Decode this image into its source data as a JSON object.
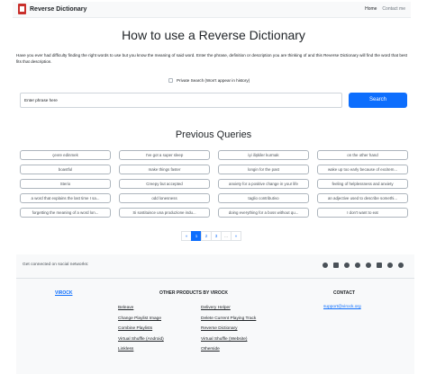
{
  "nav": {
    "brand": "Reverse Dictionary",
    "links": [
      "Home",
      "Contact me"
    ]
  },
  "main": {
    "title": "How to use a Reverse Dictionary",
    "intro": "Have you ever had difficulty finding the right words to use but you know the meaning of said word. Enter the phrase, definition or description you are thinking of and this Reverse Dictionary will find the word that best fits that description.",
    "private_label": "Private Search (Won't appear in history)",
    "search_placeholder": "Enter phrase here",
    "search_button": "Search"
  },
  "queries": {
    "title": "Previous Queries",
    "items": [
      "çevre edinmek",
      "I've got a super sleep",
      "iyi ilişkiler kurmak",
      "on the other hand",
      "boastful",
      "make things faster",
      "longin for the past",
      "wake up too early because of excitem...",
      "Sterio",
      "Creepy but accepted",
      "anxiety for a positive change in your life",
      "feeling of helplessness and anxiety",
      "a word that explains the last time I sa...",
      "odd lonesness",
      "taglio contributivo",
      "an adjective used to describe somethi...",
      "forgetting the meaning of a word lon...",
      "Si sostituisce una produzione indu...",
      "doing everything for a boss without qu...",
      "I don't want to eat"
    ]
  },
  "pagination": [
    "«",
    "1",
    "2",
    "3",
    "...",
    "»"
  ],
  "footer": {
    "social_text": "Get connected on social networks:",
    "social_icons": [
      "facebook-icon",
      "instagram-icon",
      "snapchat-icon",
      "twitter-icon",
      "telegram-icon",
      "youtube-icon",
      "tiktok-icon",
      "reddit-icon"
    ],
    "col1_title": "VIROCK",
    "col2_title": "OTHER PRODUCTS BY VIROCK",
    "col3_title": "CONTACT",
    "products_left": [
      "Beleave",
      "Change Playlist Image",
      "Combine Playlists",
      "Virtual Shuffle (Android)",
      "Linkless"
    ],
    "products_right": [
      "Delivery Helper",
      "Delete Current Playing Track",
      "Reverse Dictionary",
      "Virtual Shuffle (Website)",
      "Otherside"
    ],
    "email": "support@virock.org"
  }
}
